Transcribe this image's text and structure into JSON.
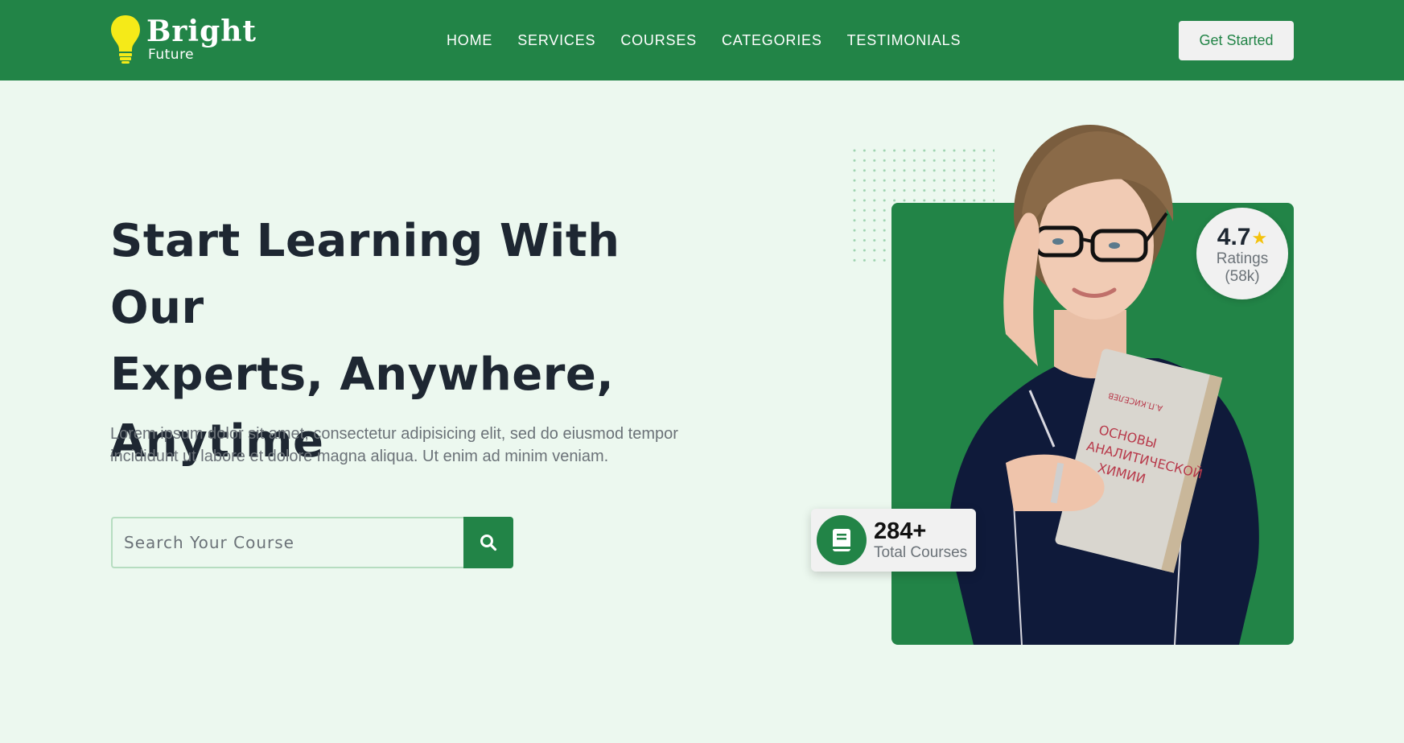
{
  "brand": {
    "name": "Bright",
    "tagline": "Future"
  },
  "nav": {
    "items": [
      {
        "label": "HOME"
      },
      {
        "label": "SERVICES"
      },
      {
        "label": "COURSES"
      },
      {
        "label": "CATEGORIES"
      },
      {
        "label": "TESTIMONIALS"
      }
    ],
    "cta_label": "Get Started"
  },
  "hero": {
    "title_lines": [
      "Start Learning With Our",
      "Experts, Anywhere,",
      "Anytime"
    ],
    "description": "Lorem ipsum dolor sit amet, consectetur adipisicing elit, sed do eiusmod tempor incididunt ut labore et dolore magna aliqua. Ut enim ad minim veniam.",
    "search": {
      "placeholder": "Search Your Course",
      "value": "",
      "button_icon": "search-icon"
    }
  },
  "rating_badge": {
    "value": "4.7",
    "icon": "star-icon",
    "label": "Ratings",
    "count": "(58k)"
  },
  "courses_badge": {
    "icon": "book-icon",
    "count": "284+",
    "label": "Total Courses"
  },
  "colors": {
    "primary": "#228447",
    "background": "#ecf8ef",
    "heading": "#1e2732",
    "muted": "#6b7278",
    "bulb": "#f5ea18",
    "star": "#f4c20d"
  }
}
